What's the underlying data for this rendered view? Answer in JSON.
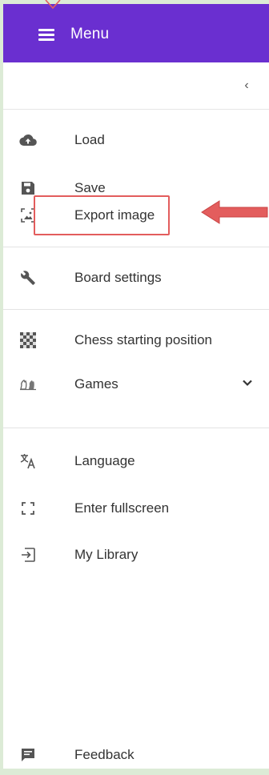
{
  "header": {
    "menu_label": "Menu",
    "background_color": "#6a2fd0"
  },
  "collapse": {
    "glyph": "‹"
  },
  "menu": {
    "items": [
      {
        "label": "Load",
        "icon": "cloud-upload-icon"
      },
      {
        "label": "Save",
        "icon": "save-icon"
      },
      {
        "label": "Export image",
        "icon": "export-image-icon"
      },
      {
        "label": "Board settings",
        "icon": "wrench-icon"
      },
      {
        "label": "Chess starting position",
        "icon": "checkerboard-icon"
      },
      {
        "label": "Games",
        "icon": "chess-pieces-icon"
      },
      {
        "label": "Language",
        "icon": "translate-icon"
      },
      {
        "label": "Enter fullscreen",
        "icon": "fullscreen-icon"
      },
      {
        "label": "My Library",
        "icon": "library-icon"
      },
      {
        "label": "Feedback",
        "icon": "feedback-icon"
      }
    ]
  },
  "annotation": {
    "highlight_color": "#e35d5d"
  }
}
